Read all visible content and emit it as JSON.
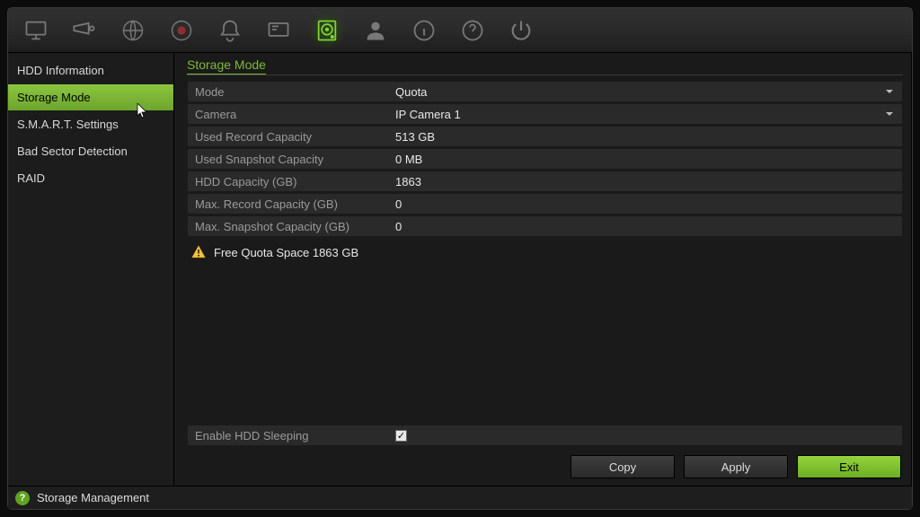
{
  "toolbar": {
    "icons": [
      "monitor",
      "camera",
      "globe",
      "record",
      "alarm",
      "screen",
      "hdd",
      "user",
      "info",
      "help",
      "power"
    ],
    "active_index": 6
  },
  "sidebar": {
    "items": [
      {
        "label": "HDD Information"
      },
      {
        "label": "Storage Mode"
      },
      {
        "label": "S.M.A.R.T. Settings"
      },
      {
        "label": "Bad Sector Detection"
      },
      {
        "label": "RAID"
      }
    ],
    "active_index": 1
  },
  "section": {
    "title": "Storage Mode"
  },
  "form": {
    "mode": {
      "label": "Mode",
      "value": "Quota",
      "dropdown": true
    },
    "camera": {
      "label": "Camera",
      "value": "IP Camera 1",
      "dropdown": true
    },
    "used_record": {
      "label": "Used Record Capacity",
      "value": "513 GB"
    },
    "used_snapshot": {
      "label": "Used Snapshot Capacity",
      "value": "0 MB"
    },
    "hdd_capacity": {
      "label": "HDD Capacity (GB)",
      "value": "1863"
    },
    "max_record": {
      "label": "Max. Record Capacity (GB)",
      "value": "0"
    },
    "max_snapshot": {
      "label": "Max. Snapshot Capacity (GB)",
      "value": "0"
    }
  },
  "notice": {
    "text": "Free Quota Space 1863 GB"
  },
  "sleeping_row": {
    "label": "Enable HDD Sleeping",
    "checked": true
  },
  "buttons": {
    "copy": "Copy",
    "apply": "Apply",
    "exit": "Exit"
  },
  "status": {
    "text": "Storage Management"
  }
}
